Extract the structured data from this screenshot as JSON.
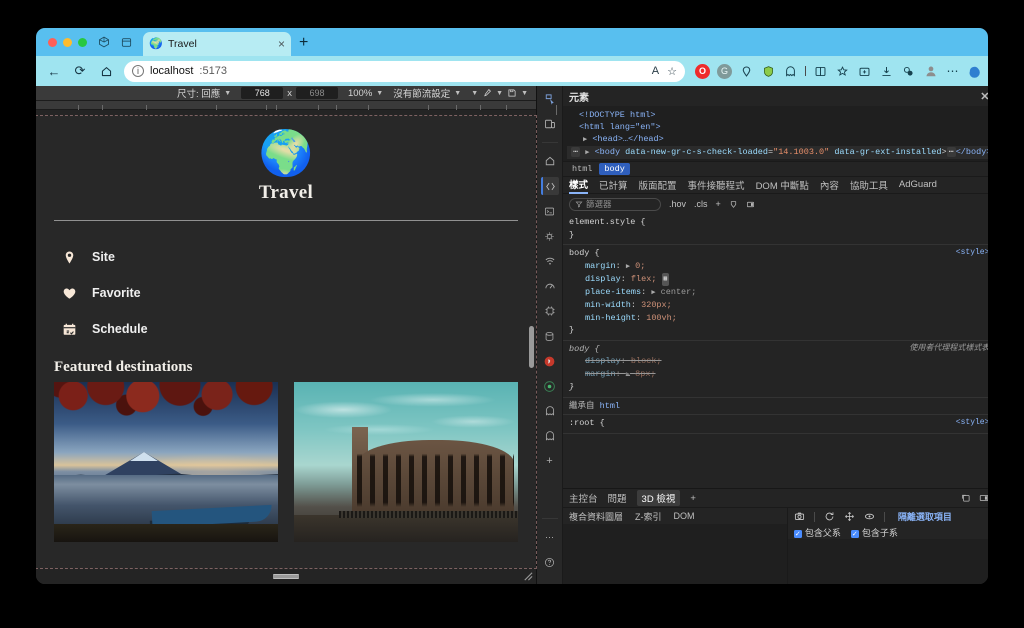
{
  "browser": {
    "window_controls": [
      "close",
      "minimize",
      "maximize"
    ],
    "toolbar_icons": [
      "workspaces-icon",
      "tab-actions-icon"
    ],
    "tab": {
      "title": "Travel",
      "favicon": "🌍",
      "close_label": "×"
    },
    "new_tab_label": "+",
    "nav": {
      "back": "←",
      "reload": "⟳",
      "home": "⌂"
    },
    "omnibox": {
      "info_icon": "i",
      "host": "localhost",
      "port": ":5173",
      "read_aloud": "A",
      "favorite": "☆"
    },
    "extensions": [
      "opera-icon",
      "grammarly-icon",
      "pocket-icon",
      "shield-icon",
      "ghostery-icon",
      "split-screen-icon",
      "collections-icon",
      "browser-essentials-icon",
      "downloads-icon",
      "extensions-icon",
      "profile-icon",
      "more-icon",
      "copilot-icon"
    ]
  },
  "device_toolbar": {
    "size_label": "尺寸: 回應",
    "width": "768",
    "times": "x",
    "height": "698",
    "zoom": "100%",
    "throttle": "沒有節流設定",
    "pen_icon": "eyedropper-icon",
    "capture_icon": "screenshot-icon",
    "more_caret": "▼"
  },
  "page": {
    "logo_emoji": "🌍",
    "brand": "Travel",
    "nav_items": [
      {
        "icon": "location-pin-icon",
        "label": "Site"
      },
      {
        "icon": "heart-icon",
        "label": "Favorite"
      },
      {
        "icon": "calendar-check-icon",
        "label": "Schedule"
      }
    ],
    "section_title": "Featured destinations",
    "cards": [
      {
        "name": "mount-fuji-lake-photo"
      },
      {
        "name": "colosseum-photo"
      }
    ]
  },
  "devtools": {
    "activity_icons": [
      "inspect-icon",
      "device-toolbar-icon",
      "home-icon",
      "elements-icon",
      "console-icon",
      "sources-icon",
      "network-icon",
      "performance-icon",
      "memory-icon",
      "application-icon",
      "recorder-icon",
      "lighthouse-icon",
      "ghostery-icon",
      "adguard-icon",
      "more-tools-icon"
    ],
    "panel_title": "元素",
    "close_label": "✕",
    "dom": [
      {
        "text": "<!DOCTYPE html>",
        "type": "doctype"
      },
      {
        "text": "<html lang=\"en\">",
        "type": "tag"
      },
      {
        "text": "<head>…</head>",
        "type": "tag"
      },
      {
        "text": "<body data-new-gr-c-s-check-loaded=\"14.1003.0\" data-gr-ext-installed>…</body>",
        "type": "tag",
        "selected": true
      }
    ],
    "breadcrumbs": [
      {
        "label": "html",
        "selected": false
      },
      {
        "label": "body",
        "selected": true
      }
    ],
    "style_tabs": [
      {
        "label": "樣式",
        "selected": true
      },
      {
        "label": "已計算",
        "selected": false
      },
      {
        "label": "版面配置",
        "selected": false
      },
      {
        "label": "事件接聽程式",
        "selected": false
      },
      {
        "label": "DOM 中斷點",
        "selected": false
      },
      {
        "label": "內容",
        "selected": false
      },
      {
        "label": "協助工具",
        "selected": false
      },
      {
        "label": "AdGuard",
        "selected": false
      }
    ],
    "filter_placeholder": "篩選器",
    "filter_buttons": [
      ".hov",
      ".cls",
      "+",
      "insert-rule-icon",
      "toggle-icon"
    ],
    "css_rules": [
      {
        "selector": "element.style {",
        "source": "",
        "declarations": [],
        "close": "}"
      },
      {
        "selector": "body {",
        "source": "<style>",
        "declarations": [
          {
            "prop": "margin",
            "value": "0;",
            "triangle": true
          },
          {
            "prop": "display",
            "value": "flex;",
            "badge": "grid"
          },
          {
            "prop": "place-items",
            "value": "center;",
            "triangle": true
          },
          {
            "prop": "min-width",
            "value": "320px;"
          },
          {
            "prop": "min-height",
            "value": "100vh;"
          }
        ],
        "close": "}"
      },
      {
        "selector": "body {",
        "source": "使用者代理程式樣式表",
        "italic": true,
        "declarations": [
          {
            "prop": "display",
            "value": "block;",
            "strike": true
          },
          {
            "prop": "margin",
            "value": "8px;",
            "strike": true,
            "triangle": true
          }
        ],
        "close": "}"
      }
    ],
    "inherited_label": "繼承自",
    "inherited_target": "html",
    "root_rule": ":root {",
    "root_source": "<style>",
    "drawer_tabs": [
      {
        "label": "主控台",
        "selected": false
      },
      {
        "label": "問題",
        "selected": false
      },
      {
        "label": "3D 檢視",
        "selected": true
      }
    ],
    "drawer_add": "+",
    "drawer_right_icons": [
      "restore-drawer-icon",
      "dock-icon"
    ],
    "threed": {
      "tabs": [
        {
          "label": "複合資料圖層",
          "selected": false
        },
        {
          "label": "Z-索引",
          "selected": false
        },
        {
          "label": "DOM",
          "selected": false
        }
      ],
      "controls": [
        "camera-icon",
        "reset-icon",
        "pan-icon",
        "rotate-icon"
      ],
      "isolate_label": "隔離選取項目",
      "checkboxes": [
        {
          "label": "包含父系",
          "checked": true
        },
        {
          "label": "包含子系",
          "checked": true
        }
      ]
    },
    "bottom_icons": [
      "more-icon",
      "help-icon"
    ]
  },
  "colors": {
    "browser_accent": "#58bfef",
    "navbar": "#9fe4f0",
    "devtools_bg": "#242424",
    "page_bg": "#282828",
    "selection_blue": "#2f5fbd",
    "link_blue": "#8ab4f8"
  }
}
